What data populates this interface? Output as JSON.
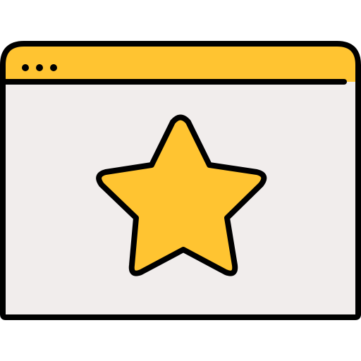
{
  "icon": {
    "name": "browser-window-star-icon",
    "colors": {
      "outline": "#000000",
      "title_bar": "#FFC431",
      "body": "#F1EDEC",
      "star": "#FFC431",
      "dots": "#000000"
    },
    "title_bar_dots": 3
  }
}
